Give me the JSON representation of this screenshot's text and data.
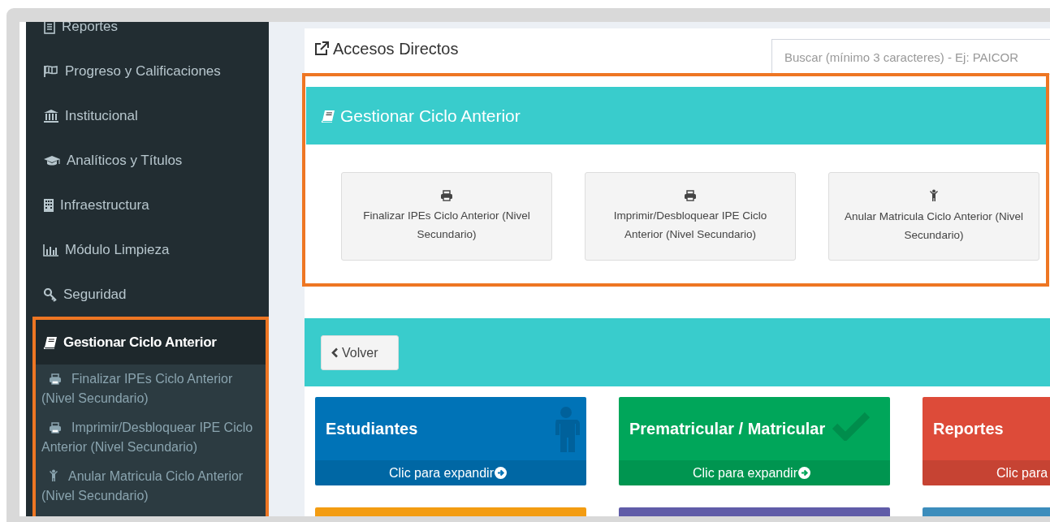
{
  "sidebar": {
    "items": [
      {
        "label": "Reportes",
        "kind": "document",
        "selected": false,
        "highlighted": false
      },
      {
        "label": "Progreso y Calificaciones",
        "kind": "flag",
        "selected": false,
        "highlighted": false
      },
      {
        "label": "Institucional",
        "kind": "bank",
        "selected": false,
        "highlighted": false
      },
      {
        "label": "Analíticos y Títulos",
        "kind": "cap",
        "selected": false,
        "highlighted": false
      },
      {
        "label": "Infraestructura",
        "kind": "building",
        "selected": false,
        "highlighted": false
      },
      {
        "label": "Módulo Limpieza",
        "kind": "chart",
        "selected": false,
        "highlighted": false
      },
      {
        "label": "Seguridad",
        "kind": "key",
        "selected": false,
        "highlighted": false
      },
      {
        "label": "Gestionar Ciclo Anterior",
        "kind": "book",
        "selected": true,
        "highlighted": true,
        "expanded": true,
        "children": [
          {
            "label": "Finalizar IPEs Ciclo Anterior (Nivel Secundario)",
            "kind": "print"
          },
          {
            "label": "Imprimir/Desbloquear IPE Ciclo Anterior (Nivel Secundario)",
            "kind": "print"
          },
          {
            "label": "Anular Matricula Ciclo Anterior (Nivel Secundario)",
            "kind": "child"
          }
        ]
      }
    ]
  },
  "header": {
    "title": "Accesos Directos",
    "search": {
      "placeholder": "Buscar (mínimo 3 caracteres) - Ej: PAICOR"
    }
  },
  "section": {
    "title": "Gestionar Ciclo Anterior",
    "highlighted": true,
    "cards": [
      {
        "label": "Finalizar IPEs Ciclo Anterior (Nivel Secundario)",
        "kind": "print"
      },
      {
        "label": "Imprimir/Desbloquear IPE Ciclo Anterior (Nivel Secundario)",
        "kind": "print"
      },
      {
        "label": "Anular Matricula Ciclo Anterior (Nivel Secundario)",
        "kind": "child"
      }
    ]
  },
  "back_button": "Volver",
  "tiles": [
    {
      "title": "Estudiantes",
      "footer": "Clic para expandir",
      "kind": "person",
      "arrow": true,
      "color": "#0073b7"
    },
    {
      "title": "Prematricular / Matricular",
      "footer": "Clic para expandir",
      "kind": "check",
      "arrow": true,
      "color": "#00a65a"
    },
    {
      "title": "Reportes",
      "footer": "Clic para",
      "kind": "plain",
      "arrow": false,
      "color": "#dd4b39"
    }
  ],
  "tiles_row_2": [
    {
      "color": "#f39c12"
    },
    {
      "color": "#605ca8"
    },
    {
      "color": "#3c8dbc"
    }
  ]
}
